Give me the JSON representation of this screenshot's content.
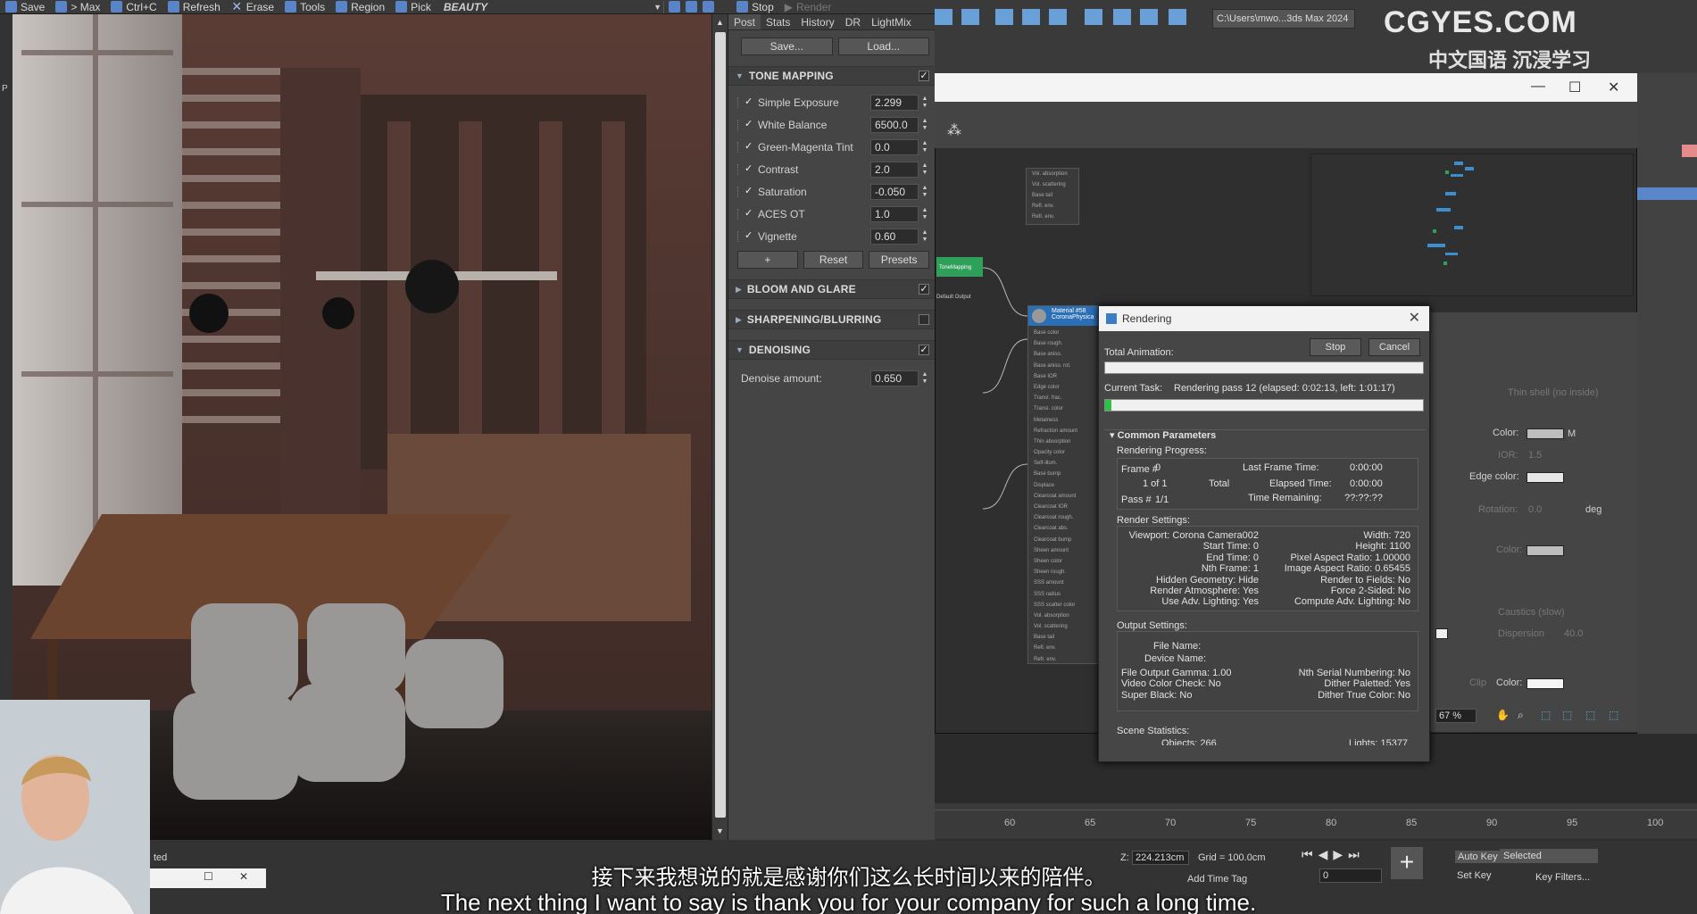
{
  "toolbar": {
    "save": "Save",
    "max": "> Max",
    "copy": "Ctrl+C",
    "refresh": "Refresh",
    "erase": "Erase",
    "tools": "Tools",
    "region": "Region",
    "pick": "Pick",
    "channel": "BEAUTY",
    "stop": "Stop",
    "render": "Render"
  },
  "left_strip": {
    "label": "P"
  },
  "post": {
    "tabs": [
      "Post",
      "Stats",
      "History",
      "DR",
      "LightMix"
    ],
    "save_btn": "Save...",
    "load_btn": "Load...",
    "tone_mapping": {
      "title": "TONE MAPPING",
      "params": [
        {
          "label": "Simple Exposure",
          "value": "2.299"
        },
        {
          "label": "White Balance",
          "value": "6500.0"
        },
        {
          "label": "Green-Magenta Tint",
          "value": "0.0"
        },
        {
          "label": "Contrast",
          "value": "2.0"
        },
        {
          "label": "Saturation",
          "value": "-0.050"
        },
        {
          "label": "ACES OT",
          "value": "1.0"
        },
        {
          "label": "Vignette",
          "value": "0.60"
        }
      ],
      "add_btn": "+",
      "reset_btn": "Reset",
      "presets_btn": "Presets"
    },
    "bloom_title": "BLOOM AND GLARE",
    "sharpen_title": "SHARPENING/BLURRING",
    "denoise": {
      "title": "DENOISING",
      "label": "Denoise amount:",
      "value": "0.650"
    }
  },
  "header_path": "C:\\Users\\mwo...3ds Max 2024",
  "watermark": {
    "main": "CGYES.COM",
    "sub": "中文国语 沉浸学习"
  },
  "slate": {
    "material_node": {
      "title": "Material #58",
      "subtitle": "CoronaPhysica"
    },
    "prev_node_label": "ToneMapping",
    "output_label": "Default Output",
    "top_node_lines": [
      "Vol. absorption",
      "Vol. scattering",
      "Base tail",
      "Refl. env.",
      "Refr. env."
    ],
    "material_slots": [
      "Base color",
      "Base rough.",
      "Base aniso.",
      "Base aniso. rot.",
      "Base IOR",
      "Edge color",
      "Transl. frac.",
      "Transl. color",
      "Metalness",
      "Refraction amount",
      "Thin absorption",
      "Opacity color",
      "Self-illum.",
      "Base bump",
      "Displace",
      "Clearcoat amount",
      "Clearcoat IOR",
      "Clearcoat rough.",
      "Clearcoat abs.",
      "Clearcoat bump",
      "Sheen amount",
      "Sheen color",
      "Sheen rough.",
      "SSS amount",
      "SSS radius",
      "SSS scatter color",
      "Vol. absorption",
      "Vol. scattering",
      "Base tail",
      "Refl. env.",
      "Refr. env."
    ],
    "zoom": "67 %"
  },
  "props": {
    "thin_shell": "Thin shell (no inside)",
    "color": "Color:",
    "m": "M",
    "ior_label": "IOR:",
    "ior_value": "1.5",
    "edge_color": "Edge color:",
    "rotation_label": "Rotation:",
    "rotation_value": "0.0",
    "deg": "deg",
    "color2": "Color:",
    "caustics": "Caustics (slow)",
    "dispersion_label": "Dispersion",
    "dispersion_value": "40.0",
    "clip": "Clip",
    "color3": "Color:"
  },
  "rendering": {
    "title": "Rendering",
    "total_animation": "Total Animation:",
    "stop": "Stop",
    "cancel": "Cancel",
    "current_task_label": "Current Task:",
    "current_task": "Rendering pass 12 (elapsed: 0:02:13, left: 1:01:17)",
    "task_progress": 0.02,
    "common_params": "Common Parameters",
    "rendering_progress": "Rendering Progress:",
    "frame_label": "Frame #",
    "frame_value": "0",
    "last_frame_time": "Last Frame Time:",
    "last_frame_value": "0:00:00",
    "one_of_one": "1 of 1",
    "total": "Total",
    "elapsed_time": "Elapsed Time:",
    "elapsed_value": "0:00:00",
    "pass_label": "Pass #",
    "pass_value": "1/1",
    "time_remaining": "Time Remaining:",
    "time_remaining_value": "??:??:??",
    "render_settings": "Render Settings:",
    "settings_left": [
      "Viewport: Corona Camera002",
      "Start Time: 0",
      "End Time: 0",
      "Nth Frame: 1",
      "Hidden Geometry: Hide",
      "Render Atmosphere: Yes",
      "Use Adv. Lighting: Yes"
    ],
    "settings_right": [
      "Width: 720",
      "Height: 1100",
      "Pixel Aspect Ratio: 1.00000",
      "Image Aspect Ratio: 0.65455",
      "Render to Fields: No",
      "Force 2-Sided: No",
      "Compute Adv. Lighting: No"
    ],
    "output_settings": "Output Settings:",
    "file_name": "File Name:",
    "device_name": "Device Name:",
    "output_left": [
      "File Output Gamma: 1.00",
      "Video Color Check: No",
      "Super Black: No"
    ],
    "output_right": [
      "Nth Serial Numbering: No",
      "Dither Paletted: Yes",
      "Dither True Color: No"
    ],
    "scene_stats": "Scene Statistics:",
    "objects_cut": "Objects: 266",
    "lights_cut": "Lights: 15377"
  },
  "timeline_ticks": [
    "60",
    "65",
    "70",
    "75",
    "80",
    "85",
    "90",
    "95",
    "100"
  ],
  "status": {
    "z_label": "Z:",
    "z_value": "224.213cm",
    "grid": "Grid = 100.0cm",
    "auto_key": "Auto Key",
    "selected": "Selected",
    "set_key": "Set Key",
    "key_filters": "Key Filters...",
    "add_time_tag": "Add Time Tag",
    "frame_field": "0",
    "left_text": "ted"
  },
  "subtitles": {
    "zh": "接下来我想说的就是感谢你们这么长时间以来的陪伴。",
    "en": "The next thing I want to say is thank you for your company for such a long time."
  },
  "colors": {
    "accent": "#2b6fb6",
    "progress": "#2ec24a"
  }
}
